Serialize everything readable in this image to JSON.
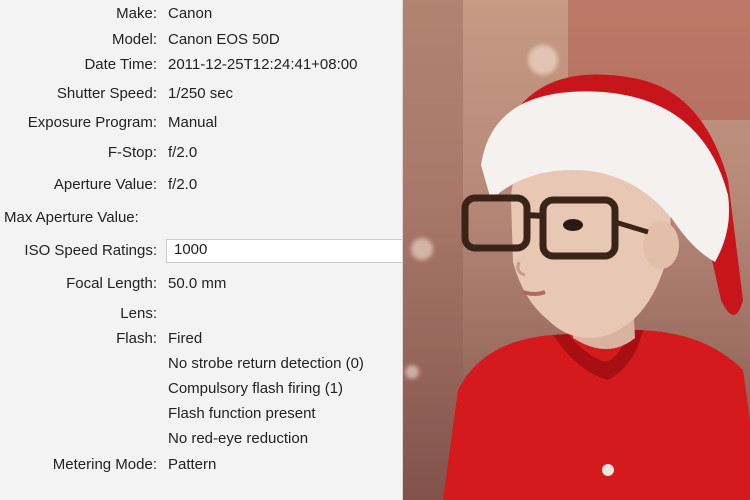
{
  "exif": {
    "make": {
      "label": "Make:",
      "value": "Canon"
    },
    "model": {
      "label": "Model:",
      "value": "Canon EOS 50D"
    },
    "datetime": {
      "label": "Date Time:",
      "value": "2011-12-25T12:24:41+08:00"
    },
    "shutter": {
      "label": "Shutter Speed:",
      "value": "1/250 sec"
    },
    "program": {
      "label": "Exposure Program:",
      "value": "Manual"
    },
    "fstop": {
      "label": "F-Stop:",
      "value": "f/2.0"
    },
    "aperture": {
      "label": "Aperture Value:",
      "value": "f/2.0"
    },
    "max_aperture": {
      "label": "Max Aperture Value:",
      "value": ""
    },
    "iso": {
      "label": "ISO Speed Ratings:",
      "value": "1000"
    },
    "focal": {
      "label": "Focal Length:",
      "value": "50.0 mm"
    },
    "lens": {
      "label": "Lens:",
      "value": ""
    },
    "flash": {
      "label": "Flash:",
      "lines": [
        "Fired",
        "No strobe return detection (0)",
        "Compulsory flash firing (1)",
        "Flash function present",
        "No red-eye reduction"
      ]
    },
    "metering": {
      "label": "Metering Mode:",
      "value": "Pattern"
    }
  },
  "photo": {
    "colors": {
      "hat_red": "#c8141b",
      "fur_white": "#f4f1ee",
      "shirt_red": "#d41a1c",
      "skin": "#e8c8b4",
      "frame": "#3a2418"
    }
  }
}
